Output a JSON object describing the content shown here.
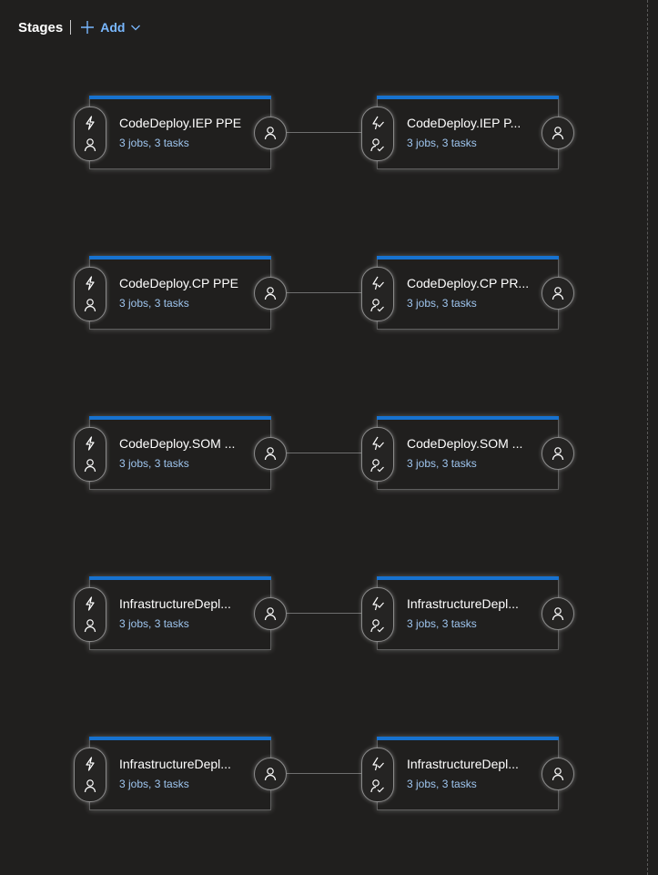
{
  "header": {
    "title": "Stages",
    "add_label": "Add"
  },
  "rows": [
    {
      "left": {
        "name": "CodeDeploy.IEP PPE",
        "meta": "3 jobs, 3 tasks"
      },
      "right": {
        "name": "CodeDeploy.IEP P...",
        "meta": "3 jobs, 3 tasks"
      }
    },
    {
      "left": {
        "name": "CodeDeploy.CP PPE",
        "meta": "3 jobs, 3 tasks"
      },
      "right": {
        "name": "CodeDeploy.CP PR...",
        "meta": "3 jobs, 3 tasks"
      }
    },
    {
      "left": {
        "name": "CodeDeploy.SOM ...",
        "meta": "3 jobs, 3 tasks"
      },
      "right": {
        "name": "CodeDeploy.SOM ...",
        "meta": "3 jobs, 3 tasks"
      }
    },
    {
      "left": {
        "name": "InfrastructureDepl...",
        "meta": "3 jobs, 3 tasks"
      },
      "right": {
        "name": "InfrastructureDepl...",
        "meta": "3 jobs, 3 tasks"
      }
    },
    {
      "left": {
        "name": "InfrastructureDepl...",
        "meta": "3 jobs, 3 tasks"
      },
      "right": {
        "name": "InfrastructureDepl...",
        "meta": "3 jobs, 3 tasks"
      }
    }
  ],
  "icons": {
    "add": "plus-icon",
    "chevron": "chevron-down-icon",
    "trigger": "lightning-icon",
    "auto_trigger": "lightning-check-icon",
    "pre_approval": "person-icon",
    "post_approval": "person-check-icon"
  },
  "colors": {
    "accent": "#1772d0",
    "link": "#79b8ff",
    "background": "#201f1e"
  }
}
